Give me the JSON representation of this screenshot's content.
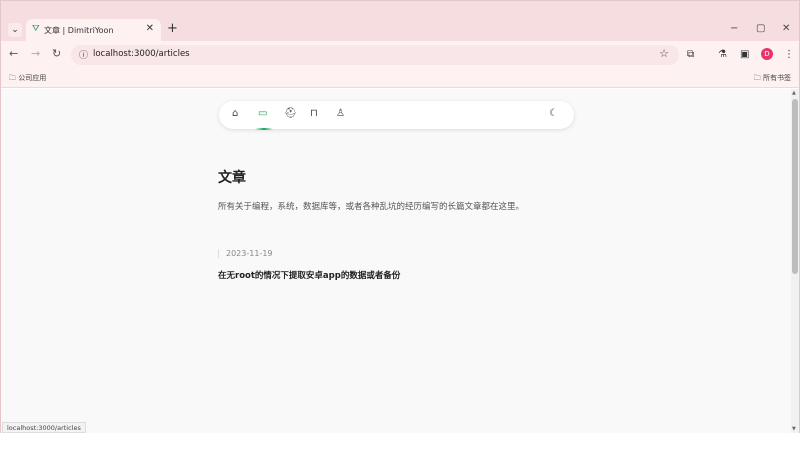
{
  "browser": {
    "tab_title": "文章 | DimitriYoon",
    "tab_close": "✕",
    "new_tab": "+",
    "window_controls": [
      "−",
      "▢",
      "✕"
    ],
    "url": "localhost:3000/articles",
    "profile_initial": "D",
    "status_url": "localhost:3000/articles",
    "colors": {
      "tab_strip": "#f6dde0",
      "toolbar": "#fdf1f2",
      "profile": "#e8336b"
    }
  },
  "bookmarks": {
    "left_folder": "公司应用",
    "right_folder": "所有书签"
  },
  "site": {
    "accent": "#18a058",
    "nav_items": [
      "home-icon",
      "articles-icon",
      "projects-icon",
      "bookmarks-icon",
      "about-icon"
    ],
    "theme_toggle": "moon-icon"
  },
  "main": {
    "title": "文章",
    "description": "所有关于编程，系统，数据库等，或者各种乱坑的经历编写的长篇文章都在这里。",
    "articles": [
      {
        "date": "2023-11-19",
        "title": "在无root的情况下提取安卓app的数据或者备份"
      }
    ]
  }
}
